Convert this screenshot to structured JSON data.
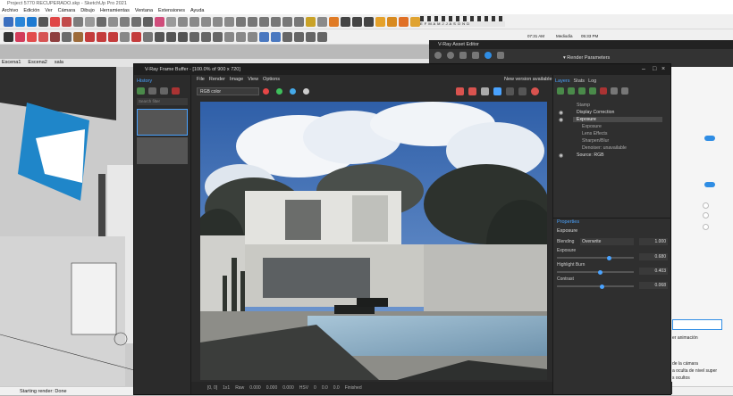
{
  "window": {
    "title": "Project 5770 RECUPERADO.skp - SketchUp Pro 2021"
  },
  "menu": [
    "Archivo",
    "Edición",
    "Ver",
    "Cámara",
    "Dibujo",
    "Herramientas",
    "Ventana",
    "Extensiones",
    "Ayuda"
  ],
  "scenes": [
    "Escena1",
    "Escena2",
    "sala"
  ],
  "shadow": {
    "months": "E F M A M J J A S O N D",
    "time1": "07:31 AM",
    "mid": "Mediodía",
    "time2": "05:33 PM"
  },
  "status": {
    "text": "Starting render: Done"
  },
  "vfb": {
    "title": "V-Ray Frame Buffer - [100.0% of 900 x 720]",
    "menu": [
      "File",
      "Render",
      "Image",
      "View",
      "Options"
    ],
    "new_version": "New version available!",
    "history_label": "History",
    "search_placeholder": "Search filter",
    "channel": "RGB color",
    "status": {
      "coords": "[0, 0]",
      "zoom": "1x1",
      "raw_label": "Raw",
      "r": "0.000",
      "g": "0.000",
      "b": "0.000",
      "mode": "HSV",
      "h": "0",
      "s": "0.0",
      "v": "0.0",
      "finished": "Finished"
    },
    "tabs": [
      "Layers",
      "Stats",
      "Log"
    ],
    "layers": [
      {
        "name": "Stamp",
        "state": "disabled"
      },
      {
        "name": "Display Correction",
        "state": "enabled"
      },
      {
        "name": "Exposure",
        "state": "selected"
      },
      {
        "name": "Exposure",
        "state": "disabled"
      },
      {
        "name": "Lens Effects",
        "state": "disabled"
      },
      {
        "name": "Sharpen/Blur",
        "state": "disabled"
      },
      {
        "name": "Denoiser: unavailable",
        "state": "disabled"
      },
      {
        "name": "Source: RGB",
        "state": "enabled"
      }
    ],
    "properties": {
      "header": "Properties",
      "section": "Exposure",
      "blending_label": "Blending",
      "blending_value": "Overwrite",
      "blending_amount": "1.000",
      "exposure_label": "Exposure",
      "exposure_value": "0.680",
      "highlight_label": "Highlight Burn",
      "highlight_value": "0.403",
      "contrast_label": "Contrast",
      "contrast_value": "0.068"
    }
  },
  "asset_editor": {
    "title": "V-Ray Asset Editor",
    "section": "Render Parameters"
  },
  "side": {
    "anim_text": "er animación",
    "cam1": "de la cámara",
    "cam2": "a oculta de nivel super",
    "cam3": "s ocultos"
  },
  "colors": {
    "accent": "#2f8de4",
    "vfb_bg": "#2b2b2b",
    "sky": "#5b87c9"
  }
}
